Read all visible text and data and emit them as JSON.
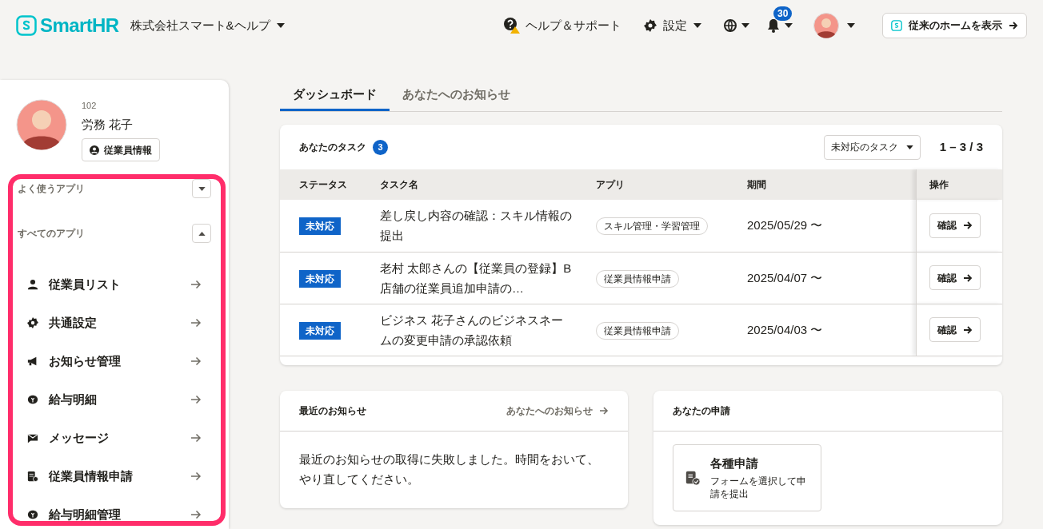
{
  "header": {
    "logo": "SmartHR",
    "company": "株式会社スマート&ヘルプ",
    "help": "ヘルプ＆サポート",
    "settings": "設定",
    "notification_count": "30",
    "classic_home_button": "従来のホームを表示"
  },
  "sidebar": {
    "profile": {
      "employee_number": "102",
      "name": "労務 花子",
      "button": "従業員情報"
    },
    "sections": [
      {
        "title": "よく使うアプリ",
        "expanded": false
      },
      {
        "title": "すべてのアプリ",
        "expanded": true,
        "items": [
          {
            "label": "従業員リスト"
          },
          {
            "label": "共通設定"
          },
          {
            "label": "お知らせ管理"
          },
          {
            "label": "給与明細"
          },
          {
            "label": "メッセージ"
          },
          {
            "label": "従業員情報申請"
          },
          {
            "label": "給与明細管理"
          }
        ]
      }
    ]
  },
  "tabs": [
    {
      "label": "ダッシュボード",
      "selected": true
    },
    {
      "label": "あなたへのお知らせ",
      "selected": false
    }
  ],
  "tasks": {
    "title": "あなたのタスク",
    "count": "3",
    "filter": "未対応のタスク",
    "range": "1 – 3 / 3",
    "columns": [
      "ステータス",
      "タスク名",
      "アプリ",
      "期間",
      "操作"
    ],
    "rows": [
      {
        "status": "未対応",
        "name": "差し戻し内容の確認：スキル情報の提出",
        "app": "スキル管理・学習管理",
        "period": "2025/05/29 〜",
        "action": "確認"
      },
      {
        "status": "未対応",
        "name": "老村 太郎さんの【従業員の登録】B店舗の従業員追加申請の…",
        "app": "従業員情報申請",
        "period": "2025/04/07 〜",
        "action": "確認"
      },
      {
        "status": "未対応",
        "name": "ビジネス 花子さんのビジネスネームの変更申請の承認依頼",
        "app": "従業員情報申請",
        "period": "2025/04/03 〜",
        "action": "確認"
      }
    ]
  },
  "notices": {
    "title": "最近のお知らせ",
    "link": "あなたへのお知らせ",
    "message": "最近のお知らせの取得に失敗しました。時間をおいて、やり直してください。"
  },
  "applications": {
    "title": "あなたの申請",
    "tile": {
      "title": "各種申請",
      "description": "フォームを選択して申請を提出"
    }
  }
}
